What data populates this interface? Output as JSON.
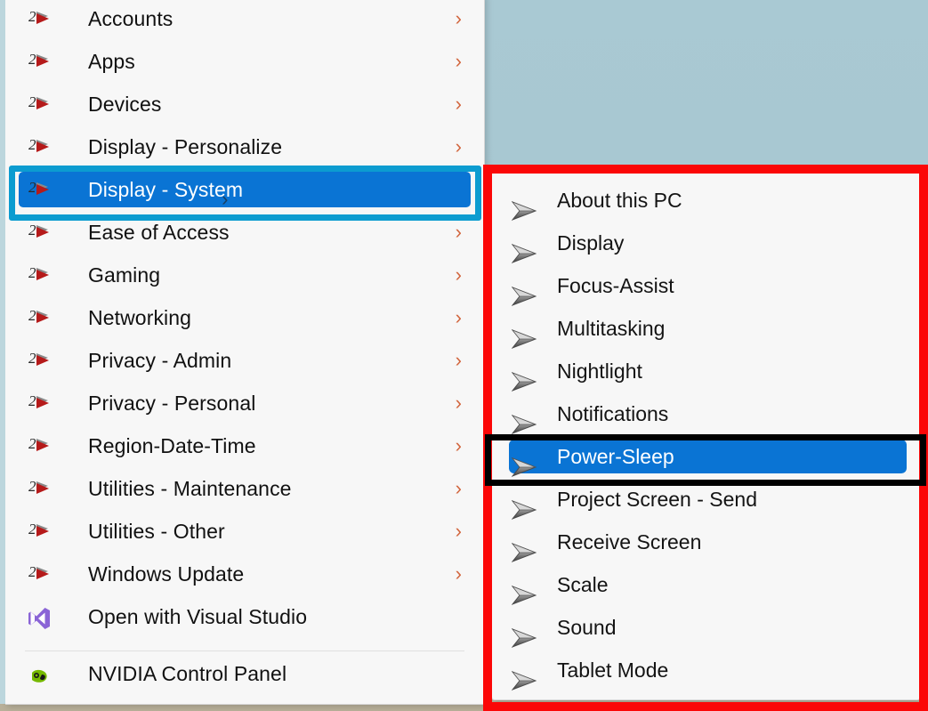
{
  "desktop": {
    "background_color": "#a9c8d2"
  },
  "context_menu": {
    "name": "settings-shortcuts-context-menu",
    "background_color": "#f7f7f7",
    "items": [
      {
        "label": "Accounts",
        "icon": "two-red-arrow-icon",
        "has_submenu": true,
        "selected": false
      },
      {
        "label": "Apps",
        "icon": "two-red-arrow-icon",
        "has_submenu": true,
        "selected": false
      },
      {
        "label": "Devices",
        "icon": "two-red-arrow-icon",
        "has_submenu": true,
        "selected": false
      },
      {
        "label": "Display - Personalize",
        "icon": "two-red-arrow-icon",
        "has_submenu": true,
        "selected": false
      },
      {
        "label": "Display - System",
        "icon": "two-red-arrow-icon",
        "has_submenu": true,
        "selected": true
      },
      {
        "label": "Ease of Access",
        "icon": "two-red-arrow-icon",
        "has_submenu": true,
        "selected": false
      },
      {
        "label": "Gaming",
        "icon": "two-red-arrow-icon",
        "has_submenu": true,
        "selected": false
      },
      {
        "label": "Networking",
        "icon": "two-red-arrow-icon",
        "has_submenu": true,
        "selected": false
      },
      {
        "label": "Privacy - Admin",
        "icon": "two-red-arrow-icon",
        "has_submenu": true,
        "selected": false
      },
      {
        "label": "Privacy - Personal",
        "icon": "two-red-arrow-icon",
        "has_submenu": true,
        "selected": false
      },
      {
        "label": "Region-Date-Time",
        "icon": "two-red-arrow-icon",
        "has_submenu": true,
        "selected": false
      },
      {
        "label": "Utilities - Maintenance",
        "icon": "two-red-arrow-icon",
        "has_submenu": true,
        "selected": false
      },
      {
        "label": "Utilities - Other",
        "icon": "two-red-arrow-icon",
        "has_submenu": true,
        "selected": false
      },
      {
        "label": "Windows Update",
        "icon": "two-red-arrow-icon",
        "has_submenu": true,
        "selected": false
      },
      {
        "label": "Open with Visual Studio",
        "icon": "visual-studio-icon",
        "has_submenu": false,
        "selected": false
      },
      {
        "label": "NVIDIA Control Panel",
        "icon": "nvidia-icon",
        "has_submenu": false,
        "selected": false
      }
    ],
    "submenu_chevron": "›"
  },
  "submenu": {
    "name": "display-system-submenu",
    "parent_item": "Display - System",
    "background_color": "#f7f7f7",
    "items": [
      {
        "label": "About this PC",
        "icon": "grey-arrow-icon",
        "selected": false
      },
      {
        "label": "Display",
        "icon": "grey-arrow-icon",
        "selected": false
      },
      {
        "label": "Focus-Assist",
        "icon": "grey-arrow-icon",
        "selected": false
      },
      {
        "label": "Multitasking",
        "icon": "grey-arrow-icon",
        "selected": false
      },
      {
        "label": "Nightlight",
        "icon": "grey-arrow-icon",
        "selected": false
      },
      {
        "label": "Notifications",
        "icon": "grey-arrow-icon",
        "selected": false
      },
      {
        "label": "Power-Sleep",
        "icon": "grey-arrow-icon",
        "selected": true
      },
      {
        "label": "Project Screen - Send",
        "icon": "grey-arrow-icon",
        "selected": false
      },
      {
        "label": "Receive Screen",
        "icon": "grey-arrow-icon",
        "selected": false
      },
      {
        "label": "Scale",
        "icon": "grey-arrow-icon",
        "selected": false
      },
      {
        "label": "Sound",
        "icon": "grey-arrow-icon",
        "selected": false
      },
      {
        "label": "Tablet Mode",
        "icon": "grey-arrow-icon",
        "selected": false
      }
    ]
  },
  "annotations": [
    {
      "name": "cyan-highlight-box",
      "color": "#0c9cd0",
      "target": "Display - System"
    },
    {
      "name": "red-highlight-box",
      "color": "#fb0707",
      "target": "display-system-submenu"
    },
    {
      "name": "black-highlight-box",
      "color": "#000000",
      "target": "Power-Sleep"
    }
  ],
  "colors": {
    "selection_blue": "#0a74d4",
    "menu_background": "#f7f7f7",
    "text": "#111111",
    "selected_text": "#ffffff",
    "chevron": "#d2663e"
  }
}
